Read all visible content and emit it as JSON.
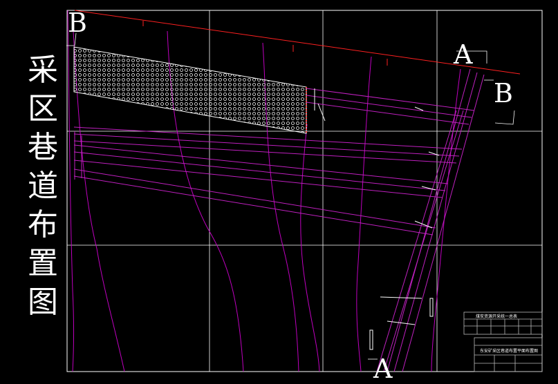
{
  "title_chars": [
    "采",
    "区",
    "巷",
    "道",
    "布",
    "置",
    "图"
  ],
  "section_labels": {
    "b_top_left": "B",
    "a_top_right": "A",
    "b_right": "B",
    "a_bottom": "A"
  },
  "colors": {
    "background": "#000000",
    "grid": "#ffffff",
    "roadway": "#c020c0",
    "contour": "#c000c0",
    "boundary": "#ff2020",
    "hatch": "#ffffff"
  },
  "legend_table": {
    "caption": "煤炭资源开采统一总表"
  },
  "title_block": {
    "caption": "东安矿采区巷道布置平面布置图"
  }
}
